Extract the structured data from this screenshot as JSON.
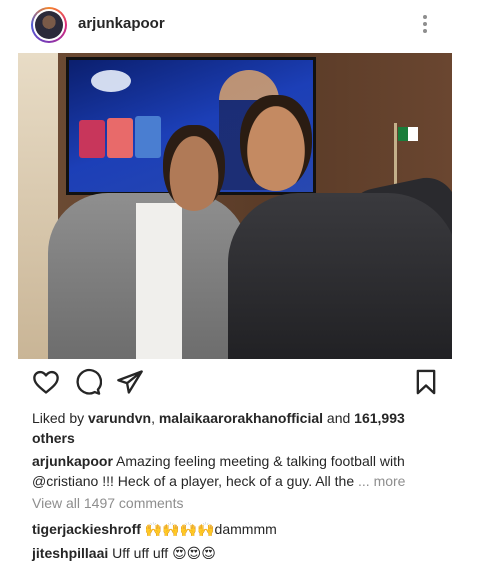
{
  "post": {
    "username": "arjunkapoor"
  },
  "likes": {
    "prefix": "Liked by ",
    "user1": "varundvn",
    "sep": ", ",
    "user2": "malaikaarorakhanofficial",
    "and": " and ",
    "count": "161,993",
    "others": "others"
  },
  "caption": {
    "username": "arjunkapoor",
    "line1": " Amazing feeling meeting & talking football with",
    "mention": "@cristiano",
    "line2": " !!! Heck of a player, heck of a guy. All the ",
    "ellipsis": "...",
    "more": "more"
  },
  "view_all": "View all 1497 comments",
  "comments": [
    {
      "username": "tigerjackieshroff",
      "text": " 🙌🙌🙌🙌dammmm"
    },
    {
      "username": "jiteshpillaai",
      "text": " Uff uff uff 😍😍😍"
    }
  ],
  "icons": {
    "more": "more-vertical-icon",
    "like": "heart-icon",
    "comment": "comment-icon",
    "share": "share-icon",
    "save": "bookmark-icon"
  }
}
